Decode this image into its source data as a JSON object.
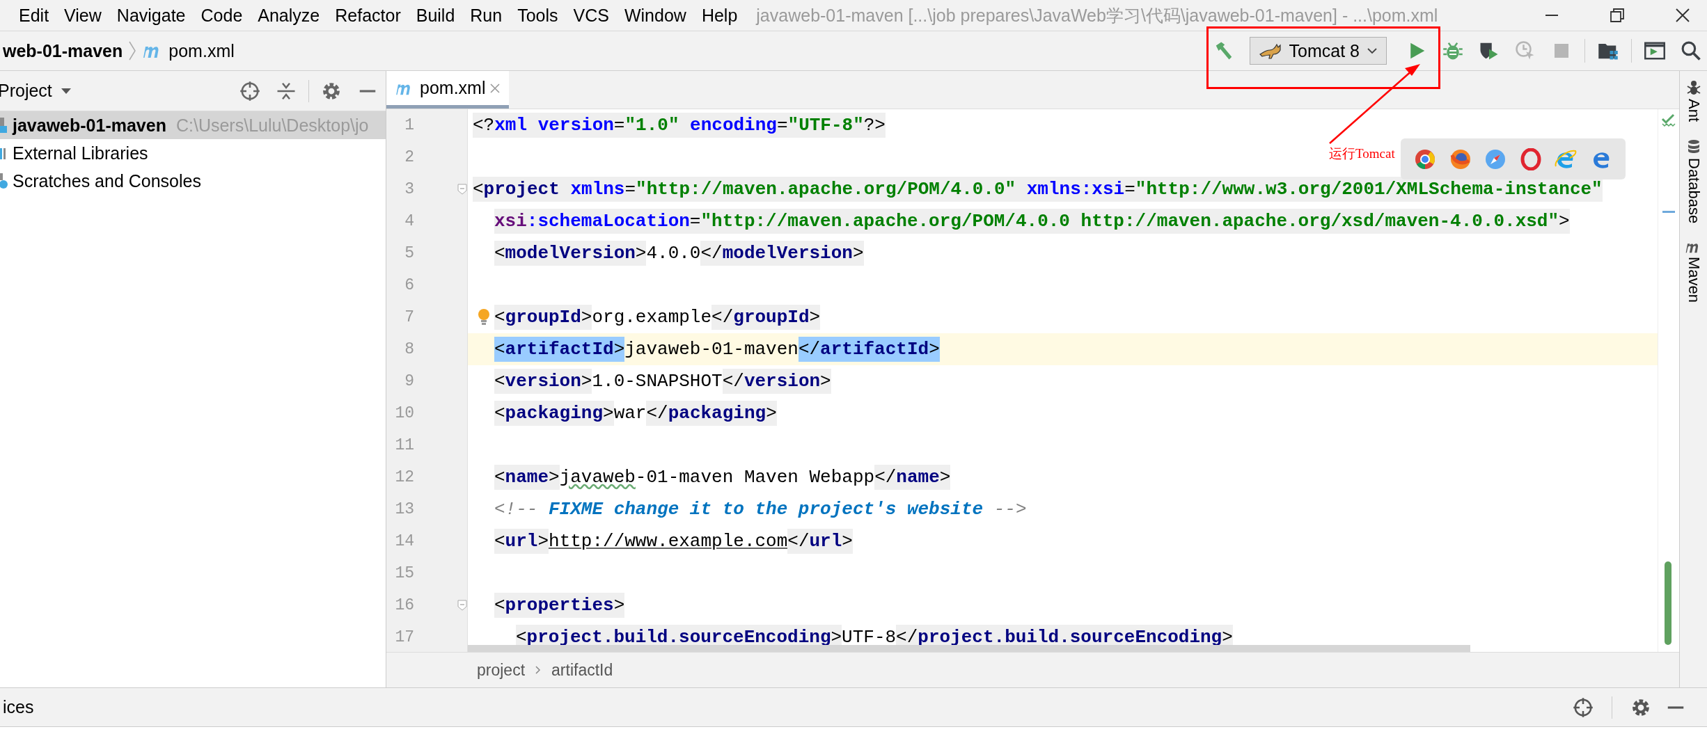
{
  "menu": [
    "Edit",
    "View",
    "Navigate",
    "Code",
    "Analyze",
    "Refactor",
    "Build",
    "Run",
    "Tools",
    "VCS",
    "Window",
    "Help"
  ],
  "window": {
    "title": "javaweb-01-maven [...\\job prepares\\JavaWeb学习\\代码\\javaweb-01-maven] - ...\\pom.xml"
  },
  "navigation": {
    "project": "web-01-maven",
    "file": "pom.xml"
  },
  "toolbar": [
    {
      "kind": "build",
      "disabled": false
    },
    {
      "kind": "run-config",
      "label": "Tomcat 8",
      "disabled": false
    },
    {
      "kind": "run",
      "disabled": false
    },
    {
      "kind": "debug",
      "disabled": false
    },
    {
      "kind": "coverage",
      "disabled": false
    },
    {
      "kind": "profile",
      "disabled": true
    },
    {
      "kind": "stop",
      "disabled": true
    },
    {
      "kind": "structure",
      "disabled": false
    },
    {
      "kind": "terminal",
      "disabled": false
    },
    {
      "kind": "search",
      "disabled": false
    }
  ],
  "project_panel": {
    "title": "Project",
    "tree": [
      {
        "kind": "module",
        "name": "javaweb-01-maven",
        "path": "C:\\Users\\Lulu\\Desktop\\jo",
        "selected": true
      },
      {
        "kind": "libraries",
        "name": "External Libraries",
        "selected": false
      },
      {
        "kind": "scratches",
        "name": "Scratches and Consoles",
        "selected": false
      }
    ]
  },
  "editor": {
    "tabs": [
      {
        "label": "pom.xml",
        "selected": true
      }
    ],
    "lines": [
      {
        "number": "1",
        "fold": false,
        "bulb": false,
        "current": false,
        "groups": [
          {
            "shaded": true,
            "matched": false,
            "tokens": [
              {
                "kind": "punct",
                "text": "<?"
              },
              {
                "kind": "keyword",
                "text": "xml"
              },
              {
                "kind": "attr",
                "text": " version"
              },
              {
                "kind": "punct",
                "text": "="
              },
              {
                "kind": "value",
                "text": "\"1.0\""
              },
              {
                "kind": "attr",
                "text": " encoding"
              },
              {
                "kind": "punct",
                "text": "="
              },
              {
                "kind": "value",
                "text": "\"UTF-8\""
              },
              {
                "kind": "punct",
                "text": "?>"
              }
            ]
          }
        ]
      },
      {
        "number": "2",
        "fold": false,
        "bulb": false,
        "current": false
      },
      {
        "number": "3",
        "fold": true,
        "bulb": false,
        "current": false,
        "groups": [
          {
            "shaded": true,
            "matched": false,
            "tokens": [
              {
                "kind": "punct",
                "text": "<"
              },
              {
                "kind": "tag",
                "text": "project"
              },
              {
                "kind": "attr",
                "text": " xmlns"
              },
              {
                "kind": "punct",
                "text": "="
              },
              {
                "kind": "value",
                "text": "\"http://maven.apache.org/POM/4.0.0\""
              },
              {
                "kind": "attr",
                "text": " xmlns:xsi"
              },
              {
                "kind": "punct",
                "text": "="
              },
              {
                "kind": "value",
                "text": "\"http://www.w3.org/2001/XMLSchema-instance\""
              }
            ]
          }
        ],
        "children": [
          {
            "number": "4",
            "fold": false,
            "bulb": false,
            "current": false,
            "groups": [
              {
                "shaded": true,
                "matched": false,
                "tokens": [
                  {
                    "kind": "ns",
                    "text": "xsi"
                  },
                  {
                    "kind": "attr",
                    "text": ":schemaLocation"
                  },
                  {
                    "kind": "punct",
                    "text": "="
                  },
                  {
                    "kind": "value",
                    "text": "\"http://maven.apache.org/POM/4.0.0 http://maven.apache.org/xsd/maven-4.0.0.xsd\""
                  },
                  {
                    "kind": "punct",
                    "text": ">"
                  }
                ]
              }
            ]
          },
          {
            "number": "5",
            "fold": false,
            "bulb": false,
            "current": false,
            "groups": [
              {
                "shaded": true,
                "matched": false,
                "tokens": [
                  {
                    "kind": "punct",
                    "text": "<"
                  },
                  {
                    "kind": "tag",
                    "text": "modelVersion"
                  },
                  {
                    "kind": "punct",
                    "text": ">"
                  }
                ]
              },
              {
                "shaded": false,
                "matched": false,
                "tokens": [
                  {
                    "kind": "text",
                    "text": "4.0.0"
                  }
                ]
              },
              {
                "shaded": true,
                "matched": false,
                "tokens": [
                  {
                    "kind": "punct",
                    "text": "</"
                  },
                  {
                    "kind": "tag",
                    "text": "modelVersion"
                  },
                  {
                    "kind": "punct",
                    "text": ">"
                  }
                ]
              }
            ]
          },
          {
            "number": "6",
            "fold": false,
            "bulb": false,
            "current": false
          },
          {
            "number": "7",
            "fold": false,
            "bulb": true,
            "current": false,
            "groups": [
              {
                "shaded": true,
                "matched": false,
                "tokens": [
                  {
                    "kind": "punct",
                    "text": "<"
                  },
                  {
                    "kind": "tag",
                    "text": "groupId"
                  },
                  {
                    "kind": "punct",
                    "text": ">"
                  }
                ]
              },
              {
                "shaded": false,
                "matched": false,
                "tokens": [
                  {
                    "kind": "text",
                    "text": "org.example"
                  }
                ]
              },
              {
                "shaded": true,
                "matched": false,
                "tokens": [
                  {
                    "kind": "punct",
                    "text": "</"
                  },
                  {
                    "kind": "tag",
                    "text": "groupId"
                  },
                  {
                    "kind": "punct",
                    "text": ">"
                  }
                ]
              }
            ]
          },
          {
            "number": "8",
            "fold": false,
            "bulb": false,
            "current": true,
            "groups": [
              {
                "shaded": true,
                "matched": true,
                "tokens": [
                  {
                    "kind": "punct",
                    "text": "<"
                  },
                  {
                    "kind": "tag",
                    "text": "artifactId"
                  },
                  {
                    "kind": "punct",
                    "text": ">"
                  }
                ]
              },
              {
                "shaded": false,
                "matched": false,
                "tokens": [
                  {
                    "kind": "text",
                    "text": "javaweb-01-maven"
                  }
                ]
              },
              {
                "shaded": true,
                "matched": true,
                "tokens": [
                  {
                    "kind": "punct",
                    "text": "</"
                  },
                  {
                    "kind": "tag",
                    "text": "artifactId"
                  },
                  {
                    "kind": "punct",
                    "text": ">"
                  }
                ]
              }
            ]
          },
          {
            "number": "9",
            "fold": false,
            "bulb": false,
            "current": false,
            "groups": [
              {
                "shaded": true,
                "matched": false,
                "tokens": [
                  {
                    "kind": "punct",
                    "text": "<"
                  },
                  {
                    "kind": "tag",
                    "text": "version"
                  },
                  {
                    "kind": "punct",
                    "text": ">"
                  }
                ]
              },
              {
                "shaded": false,
                "matched": false,
                "tokens": [
                  {
                    "kind": "text",
                    "text": "1.0-SNAPSHOT"
                  }
                ]
              },
              {
                "shaded": true,
                "matched": false,
                "tokens": [
                  {
                    "kind": "punct",
                    "text": "</"
                  },
                  {
                    "kind": "tag",
                    "text": "version"
                  },
                  {
                    "kind": "punct",
                    "text": ">"
                  }
                ]
              }
            ]
          },
          {
            "number": "10",
            "fold": false,
            "bulb": false,
            "current": false,
            "groups": [
              {
                "shaded": true,
                "matched": false,
                "tokens": [
                  {
                    "kind": "punct",
                    "text": "<"
                  },
                  {
                    "kind": "tag",
                    "text": "packaging"
                  },
                  {
                    "kind": "punct",
                    "text": ">"
                  }
                ]
              },
              {
                "shaded": false,
                "matched": false,
                "tokens": [
                  {
                    "kind": "text",
                    "text": "war"
                  }
                ]
              },
              {
                "shaded": true,
                "matched": false,
                "tokens": [
                  {
                    "kind": "punct",
                    "text": "</"
                  },
                  {
                    "kind": "tag",
                    "text": "packaging"
                  },
                  {
                    "kind": "punct",
                    "text": ">"
                  }
                ]
              }
            ]
          },
          {
            "number": "11",
            "fold": false,
            "bulb": false,
            "current": false
          },
          {
            "number": "12",
            "fold": false,
            "bulb": false,
            "current": false,
            "groups": [
              {
                "shaded": true,
                "matched": false,
                "tokens": [
                  {
                    "kind": "punct",
                    "text": "<"
                  },
                  {
                    "kind": "tag",
                    "text": "name"
                  },
                  {
                    "kind": "punct",
                    "text": ">"
                  }
                ]
              },
              {
                "shaded": false,
                "matched": false,
                "tokens": [
                  {
                    "kind": "typo",
                    "text": "javaweb"
                  },
                  {
                    "kind": "text",
                    "text": "-01-maven Maven Webapp"
                  }
                ]
              },
              {
                "shaded": true,
                "matched": false,
                "tokens": [
                  {
                    "kind": "punct",
                    "text": "</"
                  },
                  {
                    "kind": "tag",
                    "text": "name"
                  },
                  {
                    "kind": "punct",
                    "text": ">"
                  }
                ]
              }
            ]
          },
          {
            "number": "13",
            "fold": false,
            "bulb": false,
            "current": false,
            "groups": [
              {
                "shaded": false,
                "matched": false,
                "tokens": [
                  {
                    "kind": "comment",
                    "text": "<!-- "
                  },
                  {
                    "kind": "todo",
                    "text": "FIXME change it to the project's website"
                  },
                  {
                    "kind": "comment",
                    "text": " -->"
                  }
                ]
              }
            ]
          },
          {
            "number": "14",
            "fold": false,
            "bulb": false,
            "current": false,
            "groups": [
              {
                "shaded": true,
                "matched": false,
                "tokens": [
                  {
                    "kind": "punct",
                    "text": "<"
                  },
                  {
                    "kind": "tag",
                    "text": "url"
                  },
                  {
                    "kind": "punct",
                    "text": ">"
                  }
                ]
              },
              {
                "shaded": false,
                "matched": false,
                "tokens": [
                  {
                    "kind": "link",
                    "text": "http://www.example.com"
                  }
                ]
              },
              {
                "shaded": true,
                "matched": false,
                "tokens": [
                  {
                    "kind": "punct",
                    "text": "</"
                  },
                  {
                    "kind": "tag",
                    "text": "url"
                  },
                  {
                    "kind": "punct",
                    "text": ">"
                  }
                ]
              }
            ]
          },
          {
            "number": "15",
            "fold": false,
            "bulb": false,
            "current": false
          },
          {
            "number": "16",
            "fold": true,
            "bulb": false,
            "current": false,
            "groups": [
              {
                "shaded": true,
                "matched": false,
                "tokens": [
                  {
                    "kind": "punct",
                    "text": "<"
                  },
                  {
                    "kind": "tag",
                    "text": "properties"
                  },
                  {
                    "kind": "punct",
                    "text": ">"
                  }
                ]
              }
            ],
            "children": [
              {
                "number": "17",
                "fold": false,
                "bulb": false,
                "current": false,
                "groups": [
                  {
                    "shaded": true,
                    "matched": false,
                    "tokens": [
                      {
                        "kind": "punct",
                        "text": "<"
                      },
                      {
                        "kind": "tag",
                        "text": "project.build.sourceEncoding"
                      },
                      {
                        "kind": "punct",
                        "text": ">"
                      }
                    ]
                  },
                  {
                    "shaded": false,
                    "matched": false,
                    "tokens": [
                      {
                        "kind": "text",
                        "text": "UTF-8"
                      }
                    ]
                  },
                  {
                    "shaded": true,
                    "matched": false,
                    "tokens": [
                      {
                        "kind": "punct",
                        "text": "</"
                      },
                      {
                        "kind": "tag",
                        "text": "project.build.sourceEncoding"
                      },
                      {
                        "kind": "punct",
                        "text": ">"
                      }
                    ]
                  }
                ]
              }
            ]
          }
        ]
      }
    ],
    "breadcrumb": [
      "project",
      "artifactId"
    ]
  },
  "side_tools": [
    {
      "kind": "ant",
      "label": "Ant"
    },
    {
      "kind": "database",
      "label": "Database"
    },
    {
      "kind": "maven",
      "label": "Maven"
    }
  ],
  "bottom_bar": {
    "label": "ices"
  },
  "annotation": {
    "text": "运行Tomcat"
  }
}
